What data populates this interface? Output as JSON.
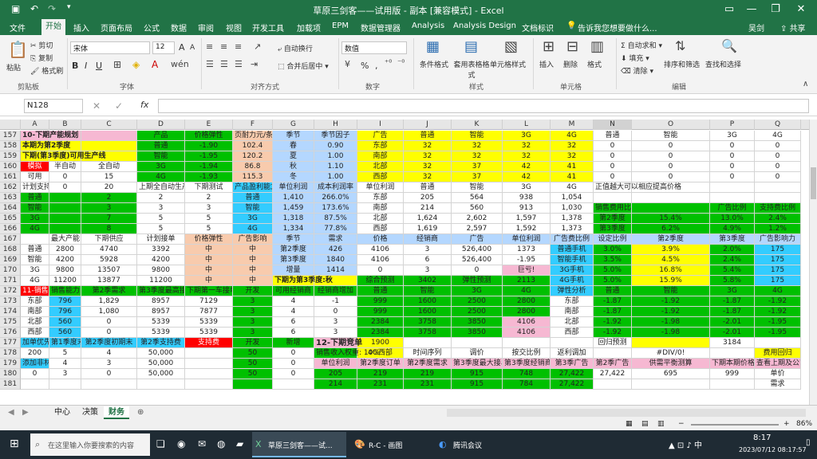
{
  "window": {
    "title": "草原三剑客——试用版 - 副本 [兼容模式] - Excel",
    "user": "吴剑",
    "share": "共享"
  },
  "menu": {
    "items": [
      "文件",
      "开始",
      "插入",
      "页面布局",
      "公式",
      "数据",
      "审阅",
      "视图",
      "开发工具",
      "加载项",
      "EPM",
      "数据管理器",
      "Analysis",
      "Analysis Design",
      "文档标识"
    ],
    "active": "开始",
    "tell_me": "告诉我您想要做什么..."
  },
  "ribbon": {
    "clipboard": {
      "paste": "粘贴",
      "cut": "剪切",
      "copy": "复制",
      "format_painter": "格式刷",
      "group": "剪贴板"
    },
    "font": {
      "name": "宋体",
      "size": "12",
      "bold": "B",
      "italic": "I",
      "underline": "U",
      "grow": "A",
      "shrink": "A",
      "group": "字体"
    },
    "alignment": {
      "wrap": "自动换行",
      "merge": "合并后居中",
      "group": "对齐方式"
    },
    "number": {
      "format": "数值",
      "percent": "%",
      "comma": ",",
      "group": "数字"
    },
    "styles": {
      "conditional": "条件格式",
      "table": "套用表格格式",
      "cell_styles": "单元格样式",
      "group": "样式"
    },
    "cells": {
      "insert": "插入",
      "delete": "删除",
      "format": "格式",
      "group": "单元格"
    },
    "editing": {
      "autosum": "自动求和",
      "fill": "填充",
      "clear": "清除",
      "sort": "排序和筛选",
      "find": "查找和选择",
      "group": "编辑"
    }
  },
  "formula_bar": {
    "name_box": "N128",
    "fx": "fx",
    "formula": ""
  },
  "grid": {
    "columns": [
      "A",
      "B",
      "C",
      "D",
      "E",
      "F",
      "G",
      "H",
      "I",
      "J",
      "K",
      "L",
      "M",
      "N",
      "O",
      "P",
      "Q"
    ],
    "selected_column": "N",
    "rows": [
      {
        "n": "157",
        "cells": [
          "10-下期产能规划",
          "",
          "",
          "产品",
          "价格弹性",
          "页耐力元/条",
          "季节",
          "季节因子",
          "广告",
          "普通",
          "智能",
          "3G",
          "4G",
          "普通",
          "智能",
          "3G",
          "4G"
        ]
      },
      {
        "n": "158",
        "cells": [
          "本期为第2季度",
          "",
          "",
          "普通",
          "-1.90",
          "102.4",
          "春",
          "0.90",
          "东部",
          "32",
          "32",
          "32",
          "32",
          "0",
          "0",
          "0",
          "0"
        ]
      },
      {
        "n": "159",
        "cells": [
          "下期(第3季度)可用生产线",
          "",
          "",
          "智能",
          "-1.95",
          "120.2",
          "夏",
          "1.00",
          "南部",
          "32",
          "32",
          "32",
          "32",
          "0",
          "0",
          "0",
          "0"
        ]
      },
      {
        "n": "160",
        "cells": [
          "模拟",
          "半自动",
          "全自动",
          "3G",
          "-1.94",
          "86.8",
          "秋",
          "1.10",
          "北部",
          "32",
          "37",
          "42",
          "41",
          "0",
          "0",
          "0",
          "0"
        ]
      },
      {
        "n": "161",
        "cells": [
          "可用",
          "0",
          "15",
          "4G",
          "-1.93",
          "115.3",
          "冬",
          "1.00",
          "西部",
          "32",
          "37",
          "42",
          "41",
          "0",
          "0",
          "0",
          "0"
        ]
      },
      {
        "n": "162",
        "cells": [
          "计划支持",
          "0",
          "20",
          "上期全自动生产",
          "下期测试",
          "产品盈利能力",
          "单位利润",
          "成本利润率",
          "单位利润",
          "普通",
          "智能",
          "3G",
          "4G",
          "正值越大可以相应提高价格",
          "",
          "",
          ""
        ]
      },
      {
        "n": "163",
        "cells": [
          "普通",
          "",
          "2",
          "2",
          "2",
          "普通",
          "1,410",
          "266.0%",
          "东部",
          "205",
          "564",
          "938",
          "1,054",
          "",
          "",
          "",
          ""
        ]
      },
      {
        "n": "164",
        "cells": [
          "智能",
          "",
          "3",
          "3",
          "3",
          "智能",
          "1,459",
          "173.6%",
          "南部",
          "214",
          "560",
          "913",
          "1,030",
          "销售费用比例",
          "",
          "广告比例",
          "支持费比例"
        ]
      },
      {
        "n": "165",
        "cells": [
          "3G",
          "",
          "7",
          "5",
          "5",
          "3G",
          "1,318",
          "87.5%",
          "北部",
          "1,624",
          "2,602",
          "1,597",
          "1,378",
          "第2季度",
          "15.4%",
          "13.0%",
          "2.4%"
        ]
      },
      {
        "n": "166",
        "cells": [
          "4G",
          "",
          "8",
          "5",
          "5",
          "4G",
          "1,334",
          "77.8%",
          "西部",
          "1,619",
          "2,597",
          "1,592",
          "1,373",
          "第3季度",
          "6.2%",
          "4.9%",
          "1.2%"
        ]
      },
      {
        "n": "167",
        "cells": [
          "",
          "最大产能",
          "下期供应",
          "计划接单",
          "价格弹性",
          "广告影响",
          "季节",
          "需求",
          "价格",
          "经销商",
          "广告",
          "单位利润",
          "广告费比例",
          "设定比例",
          "第2季度",
          "第3季度",
          "广告影响力"
        ]
      },
      {
        "n": "168",
        "cells": [
          "普通",
          "2800",
          "4740",
          "3392",
          "中",
          "中",
          "第2季度",
          "426",
          "4106",
          "3",
          "526,400",
          "1373",
          "普通手机",
          "3.0%",
          "3.9%",
          "2.0%",
          "175"
        ]
      },
      {
        "n": "169",
        "cells": [
          "智能",
          "4200",
          "5928",
          "4200",
          "中",
          "中",
          "第3季度",
          "1840",
          "4106",
          "6",
          "526,400",
          "-1.95",
          "智能手机",
          "3.5%",
          "4.5%",
          "2.4%",
          "175"
        ]
      },
      {
        "n": "170",
        "cells": [
          "3G",
          "9800",
          "13507",
          "9800",
          "中",
          "中",
          "增量",
          "1414",
          "0",
          "3",
          "0",
          "巨亏!",
          "3G手机",
          "5.0%",
          "16.8%",
          "5.4%",
          "175"
        ]
      },
      {
        "n": "171",
        "cells": [
          "4G",
          "11200",
          "13877",
          "11200",
          "中",
          "中",
          "下期为第3季度:秋",
          "",
          "综合预测",
          "3402",
          "弹性预测",
          "2113",
          "4G手机",
          "5.0%",
          "15.9%",
          "5.8%",
          "175"
        ]
      },
      {
        "n": "172",
        "cells": [
          "11-销售能力",
          "销售能力",
          "第2季需求",
          "第3季度最高接单量",
          "下期第一车接单量",
          "开发",
          "可用经销商",
          "经销商增加",
          "普通",
          "智能",
          "3G",
          "4G",
          "弹性分析",
          "普通",
          "智能",
          "3G",
          "4G"
        ]
      },
      {
        "n": "173",
        "cells": [
          "东部",
          "796",
          "1,829",
          "8957",
          "7129",
          "3",
          "4",
          "-1",
          "999",
          "1600",
          "2500",
          "2800",
          "东部",
          "-1.87",
          "-1.92",
          "-1.87",
          "-1.92"
        ]
      },
      {
        "n": "174",
        "cells": [
          "南部",
          "796",
          "1,080",
          "8957",
          "7877",
          "3",
          "4",
          "0",
          "999",
          "1600",
          "2500",
          "2800",
          "南部",
          "-1.87",
          "-1.92",
          "-1.87",
          "-1.92"
        ]
      },
      {
        "n": "175",
        "cells": [
          "北部",
          "560",
          "0",
          "5339",
          "5339",
          "3",
          "6",
          "3",
          "2384",
          "3758",
          "3850",
          "4106",
          "北部",
          "-1.92",
          "-1.98",
          "-2.01",
          "-1.95"
        ]
      },
      {
        "n": "176",
        "cells": [
          "西部",
          "560",
          "0",
          "5339",
          "5339",
          "3",
          "6",
          "3",
          "2384",
          "3758",
          "3850",
          "4106",
          "西部",
          "-1.92",
          "-1.98",
          "-2.01",
          "-1.95"
        ]
      },
      {
        "n": "177",
        "cells": [
          "加单优先",
          "第1季度末",
          "第2季度初期末",
          "第2季支持费",
          "支持费",
          "开发",
          "新增",
          "12-下期竞单",
          "1900",
          "",
          "",
          "",
          "",
          "回归预测",
          "",
          "3184",
          ""
        ]
      },
      {
        "n": "178",
        "cells": [
          "200",
          "5",
          "4",
          "50,000",
          "",
          "50",
          "0",
          "销售收入权重: 10%",
          "4G西部",
          "时间序列",
          "调价",
          "按交比例",
          "返利调加",
          "",
          "#DIV/0!",
          "",
          "费用回归"
        ]
      },
      {
        "n": "179",
        "cells": [
          "添加非林胶",
          "4",
          "3",
          "50,000",
          "",
          "50",
          "0",
          "单位利润",
          "第2季度订单",
          "第2季度需求",
          "第3季度最大接单",
          "第3季度经销商",
          "第3季广告",
          "第2季广告",
          "供需平衡测算",
          "下期本期价格",
          "查看上期及公司"
        ]
      },
      {
        "n": "180",
        "cells": [
          "0",
          "3",
          "0",
          "50,000",
          "",
          "50",
          "0",
          "205",
          "219",
          "219",
          "915",
          "748",
          "27,422",
          "27,422",
          "695",
          "999",
          "单价"
        ]
      },
      {
        "n": "181",
        "cells": [
          "",
          "",
          "",
          "",
          "",
          "",
          "",
          "214",
          "231",
          "231",
          "915",
          "784",
          "27,422",
          "",
          "",
          "",
          "需求"
        ]
      }
    ]
  },
  "sheets": {
    "tabs": [
      "中心",
      "决策",
      "财务"
    ],
    "active": "财务"
  },
  "status": {
    "zoom": "86%"
  },
  "taskbar": {
    "search": "在这里输入你要搜索的内容",
    "apps": [
      "草原三剑客——试...",
      "R-C - 画图",
      "腾讯会议"
    ],
    "time": "8:17",
    "date": "2023/07/12 08:17:57"
  },
  "colors": {
    "excel_green": "#217346",
    "pink": "#f6b8d2",
    "green": "#00c000",
    "yellow": "#ffff00",
    "cyan": "#33ccff",
    "orange": "#f8cbad",
    "sky": "#b4d7ff",
    "red": "#ff0000",
    "white": "#ffffff"
  }
}
